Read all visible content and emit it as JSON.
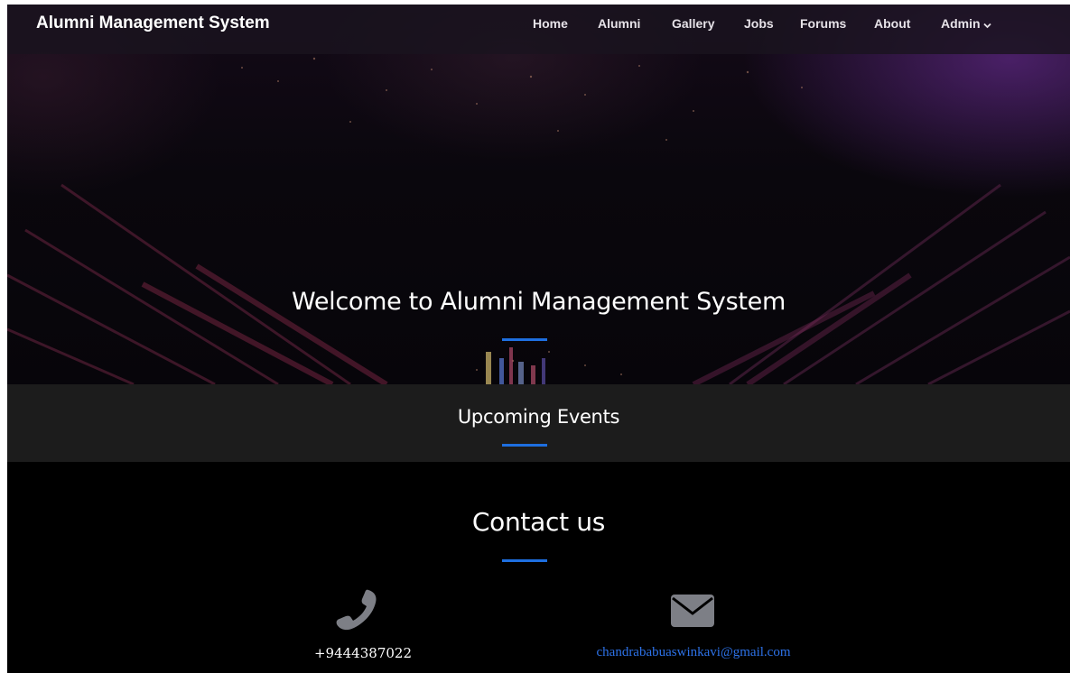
{
  "navbar": {
    "brand": "Alumni Management System",
    "items": [
      {
        "label": "Home"
      },
      {
        "label": "Alumni"
      },
      {
        "label": "Gallery"
      },
      {
        "label": "Jobs"
      },
      {
        "label": "Forums"
      },
      {
        "label": "About"
      },
      {
        "label": "Admin"
      }
    ],
    "admin_icon": "chevron-down-icon"
  },
  "hero": {
    "title": "Welcome to Alumni Management System"
  },
  "events": {
    "title": "Upcoming Events"
  },
  "contact": {
    "title": "Contact us",
    "phone": "+9444387022",
    "email": "chandrababuaswinkavi@gmail.com",
    "phone_icon": "phone-icon",
    "email_icon": "envelope-icon"
  },
  "colors": {
    "accent": "#1e6fe0",
    "link": "#2d72e8",
    "icon_gray": "#7d7f86",
    "events_band": "#1c1c1c"
  }
}
